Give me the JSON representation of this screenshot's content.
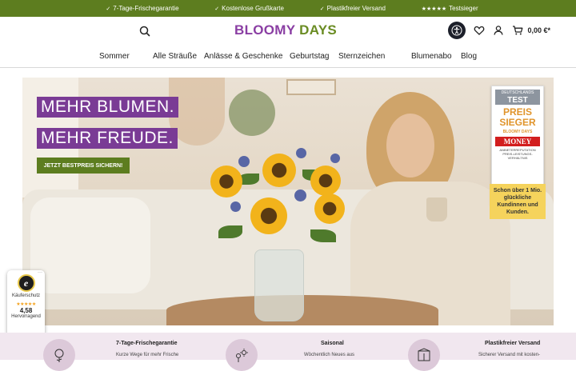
{
  "promo_bar": {
    "items": [
      "7-Tage-Frischegarantie",
      "Kostenlose Grußkarte",
      "Plastikfreier Versand",
      "Testsieger"
    ],
    "icon_names": [
      "check-icon",
      "check-icon",
      "check-icon",
      "stars-icon"
    ],
    "bg_color": "#5d7d1f"
  },
  "header": {
    "logo_primary": "BLOOMY",
    "logo_secondary": "DAYS",
    "cart_total": "0,00 €*",
    "brand_color": "#8a3ea3",
    "accent_color": "#6a8c23"
  },
  "nav": {
    "items": [
      "Sommer",
      "Alle Sträuße",
      "Anlässe & Geschenke",
      "Geburtstag",
      "Sternzeichen",
      "Blumenabo",
      "Blog"
    ]
  },
  "hero": {
    "headline_1": "MEHR BLUMEN.",
    "headline_2": "MEHR FREUDE.",
    "cta_label": "JETZT BESTPREIS SICHERN!",
    "award": {
      "top": "DEUTSCHLANDS",
      "test": "TEST",
      "title_1": "PREIS",
      "title_2": "SIEGER",
      "brand": "BLOOMY DAYS",
      "publisher": "MONEY",
      "subtitle": "ANBIETERREPUTATION PREIS-LEISTUNGS-VERHÄLTNIS"
    },
    "sticker_text": "Schon über 1 Mio. glückliche Kundinnen und Kunden."
  },
  "trust_badge": {
    "seal_letter": "e",
    "label": "Käuferschutz",
    "stars": "★★★★★",
    "score": "4,58",
    "rating_text": "Hervorragend",
    "more": "···"
  },
  "features": [
    {
      "title": "7-Tage-Frischegarantie",
      "text": "Kurze Wege für mehr Frische",
      "icon": "rose-icon"
    },
    {
      "title": "Saisonal",
      "text": "Wöchentlich Neues aus",
      "icon": "sun-flower-icon"
    },
    {
      "title": "Plastikfreier Versand",
      "text": "Sicherer Versand mit kosten-",
      "icon": "box-icon"
    }
  ]
}
